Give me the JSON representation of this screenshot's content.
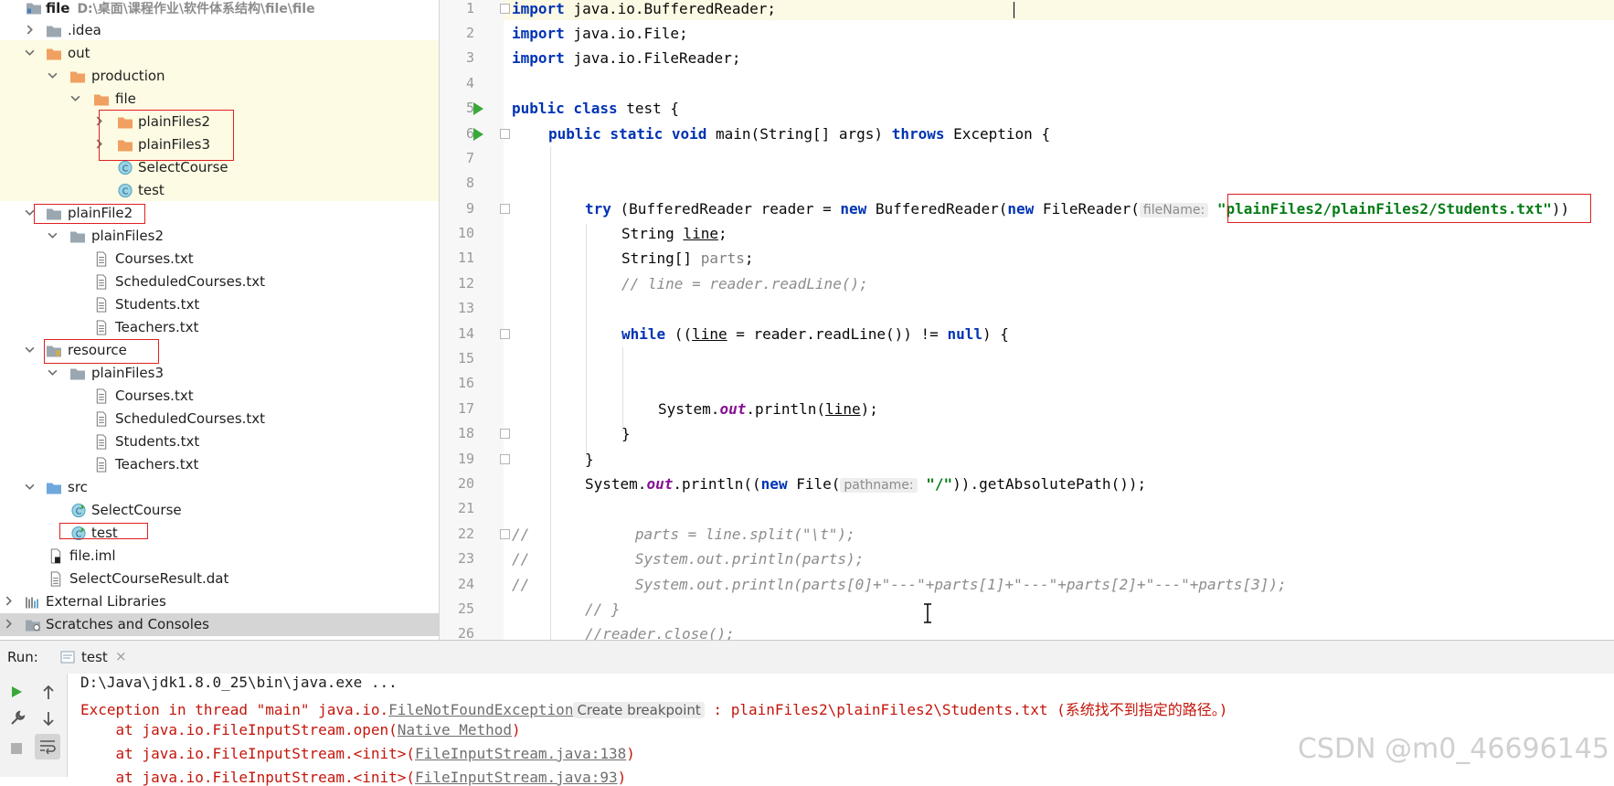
{
  "tree": {
    "rows": [
      {
        "label": "file",
        "path": "D:\\桌面\\课程作业\\软件体系结构\\file\\file"
      },
      {
        "label": ".idea"
      },
      {
        "label": "out"
      },
      {
        "label": "production"
      },
      {
        "label": "file"
      },
      {
        "label": "plainFiles2"
      },
      {
        "label": "plainFiles3"
      },
      {
        "label": "SelectCourse"
      },
      {
        "label": "test"
      },
      {
        "label": "plainFile2"
      },
      {
        "label": "plainFiles2"
      },
      {
        "label": "Courses.txt"
      },
      {
        "label": "ScheduledCourses.txt"
      },
      {
        "label": "Students.txt"
      },
      {
        "label": "Teachers.txt"
      },
      {
        "label": "resource"
      },
      {
        "label": "plainFiles3"
      },
      {
        "label": "Courses.txt"
      },
      {
        "label": "ScheduledCourses.txt"
      },
      {
        "label": "Students.txt"
      },
      {
        "label": "Teachers.txt"
      },
      {
        "label": "src"
      },
      {
        "label": "SelectCourse"
      },
      {
        "label": "test"
      },
      {
        "label": "file.iml"
      },
      {
        "label": "SelectCourseResult.dat"
      },
      {
        "label": "External Libraries"
      },
      {
        "label": "Scratches and Consoles"
      }
    ]
  },
  "editor": {
    "lines": [
      "1",
      "2",
      "3",
      "4",
      "5",
      "6",
      "7",
      "8",
      "9",
      "10",
      "11",
      "12",
      "13",
      "14",
      "15",
      "16",
      "17",
      "18",
      "19",
      "20",
      "21",
      "22",
      "23",
      "24",
      "25",
      "26"
    ],
    "code": {
      "l1_kw": "import",
      "l1_rest": " java.io.BufferedReader;",
      "l2_kw": "import",
      "l2_rest": " java.io.File;",
      "l3_kw": "import",
      "l3_rest": " java.io.FileReader;",
      "l5_kw": "public class",
      "l5_rest": " test {",
      "l6_kw1": "public static void",
      "l6_mid": " main(String[] args) ",
      "l6_kw2": "throws",
      "l6_rest": " Exception {",
      "l9_kw1": "try",
      "l9_a": " (BufferedReader reader = ",
      "l9_kw2": "new",
      "l9_b": " BufferedReader(",
      "l9_kw3": "new",
      "l9_c": " FileReader(",
      "l9_hint": "fileName:",
      "l9_str": "\"plainFiles2/plainFiles2/Students.txt\"",
      "l9_end": "))",
      "l10_a": "String ",
      "l10_var": "line",
      "l10_end": ";",
      "l11_a": "String[] ",
      "l11_var": "parts",
      "l11_end": ";",
      "l12_cm": "// line = reader.readLine();",
      "l14_kw1": "while",
      "l14_a": " ((",
      "l14_var": "line",
      "l14_b": " = reader.readLine()) != ",
      "l14_kw2": "null",
      "l14_end": ") {",
      "l17_a": "System.",
      "l17_fld": "out",
      "l17_b": ".println(",
      "l17_var": "line",
      "l17_end": ");",
      "l18": "}",
      "l19": "}",
      "l20_a": "System.",
      "l20_fld": "out",
      "l20_b": ".println((",
      "l20_kw": "new",
      "l20_c": " File(",
      "l20_hint": "pathname:",
      "l20_str": "\"/\"",
      "l20_end": ")).getAbsolutePath());",
      "l22_cm": "//            parts = line.split(\"\\t\");",
      "l23_cm": "//            System.out.println(parts);",
      "l24_cm": "//            System.out.println(parts[0]+\"---\"+parts[1]+\"---\"+parts[2]+\"---\"+parts[3]);",
      "l25_cm": "// }",
      "l26_cm": "//reader.close();"
    }
  },
  "run": {
    "label": "Run:",
    "tab_label": "test",
    "close_glyph": "×",
    "cmd": "D:\\Java\\jdk1.8.0_25\\bin\\java.exe ...",
    "err_a": "Exception in thread \"main\" java.io.",
    "err_link": "FileNotFoundException",
    "err_bp": "Create breakpoint",
    "err_b": " : plainFiles2\\plainFiles2\\Students.txt (系统找不到指定的路径。)",
    "st1_a": "    at java.io.FileInputStream.open(",
    "st1_link": "Native Method",
    "st1_end": ")",
    "st2_a": "    at java.io.FileInputStream.<init>(",
    "st2_link": "FileInputStream.java:138",
    "st2_end": ")",
    "st3_a": "    at java.io.FileInputStream.<init>(",
    "st3_link": "FileInputStream.java:93",
    "st3_end": ")"
  },
  "watermark": "CSDN @m0_46696145"
}
